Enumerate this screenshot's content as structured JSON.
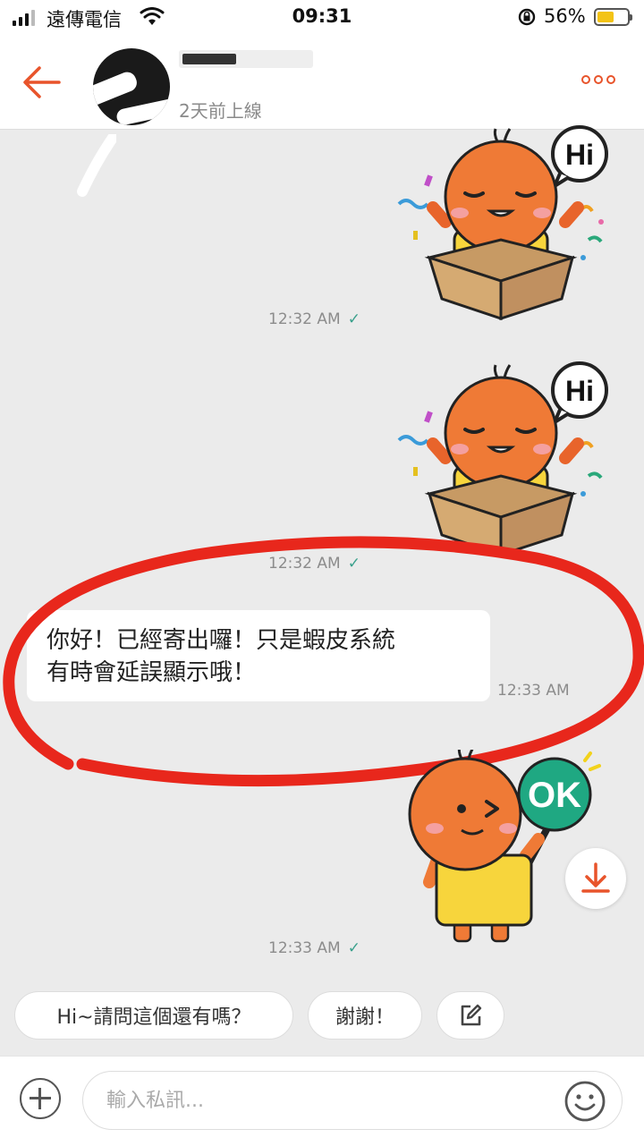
{
  "status_bar": {
    "carrier": "遠傳電信",
    "time": "09:31",
    "battery_percent": "56%",
    "battery_level": 0.56
  },
  "header": {
    "last_online": "2天前上線",
    "back_icon": "back-arrow-icon",
    "more_icon": "more-options-icon"
  },
  "messages": [
    {
      "type": "sticker",
      "sticker": "hi-box-sticker",
      "time": "12:32 AM",
      "read": true
    },
    {
      "type": "sticker",
      "sticker": "hi-box-sticker",
      "time": "12:32 AM",
      "read": true
    },
    {
      "type": "text",
      "lines": [
        "你好！已經寄出囉！只是蝦皮系統",
        "有時會延誤顯示哦！"
      ],
      "time": "12:33 AM"
    },
    {
      "type": "sticker",
      "sticker": "ok-sign-sticker",
      "time": "12:33 AM",
      "read": true
    }
  ],
  "quick_replies": [
    "Hi~請問這個還有嗎？",
    "謝謝！"
  ],
  "input": {
    "placeholder": "輸入私訊..."
  },
  "colors": {
    "accent": "#e8542b",
    "read_check": "#3aa08c",
    "background": "#ebebeb",
    "annotation_circle": "#e8271c"
  }
}
